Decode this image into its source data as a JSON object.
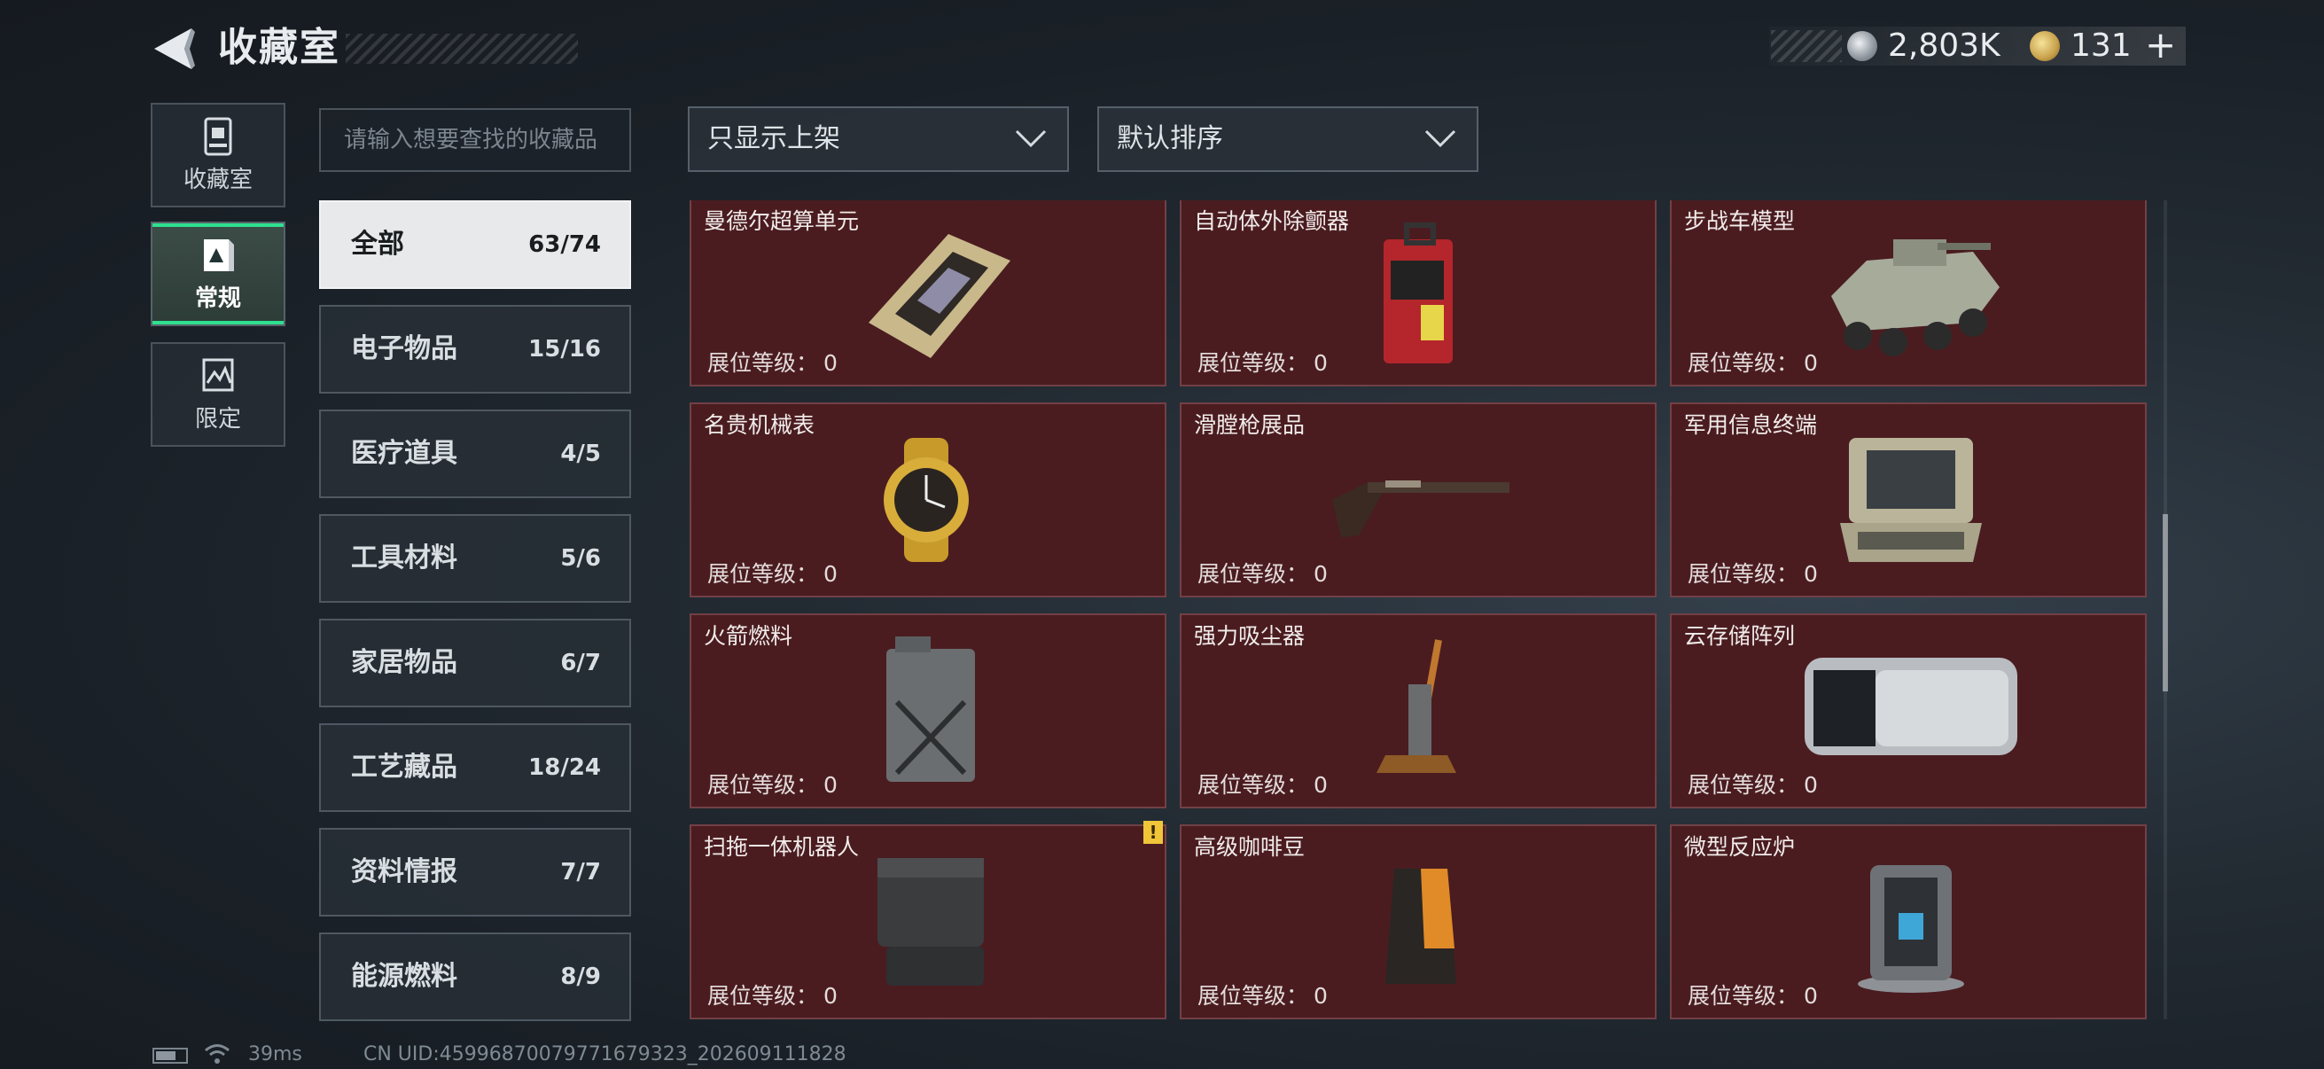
{
  "header": {
    "title": "收藏室",
    "back_icon": "back-arrow-icon"
  },
  "currency": {
    "silver_value": "2,803K",
    "gold_value": "131",
    "plus_label": "+"
  },
  "nav": [
    {
      "label": "收藏室",
      "icon": "vault-icon"
    },
    {
      "label": "常规",
      "icon": "album-icon",
      "active": true
    },
    {
      "label": "限定",
      "icon": "limited-icon"
    }
  ],
  "search": {
    "placeholder": "请输入想要查找的收藏品"
  },
  "filters": {
    "filter_label": "只显示上架",
    "sort_label": "默认排序"
  },
  "categories": [
    {
      "name": "全部",
      "count": "63/74"
    },
    {
      "name": "电子物品",
      "count": "15/16"
    },
    {
      "name": "医疗道具",
      "count": "4/5"
    },
    {
      "name": "工具材料",
      "count": "5/6"
    },
    {
      "name": "家居物品",
      "count": "6/7"
    },
    {
      "name": "工艺藏品",
      "count": "18/24"
    },
    {
      "name": "资料情报",
      "count": "7/7"
    },
    {
      "name": "能源燃料",
      "count": "8/9"
    }
  ],
  "level_prefix": "展位等级：",
  "items": [
    {
      "name": "曼德尔超算单元",
      "level": "0",
      "icon": "supercomputer-unit-icon"
    },
    {
      "name": "自动体外除颤器",
      "level": "0",
      "icon": "defibrillator-icon"
    },
    {
      "name": "步战车模型",
      "level": "0",
      "icon": "ifv-model-icon"
    },
    {
      "name": "名贵机械表",
      "level": "0",
      "icon": "watch-icon"
    },
    {
      "name": "滑膛枪展品",
      "level": "0",
      "icon": "musket-icon"
    },
    {
      "name": "军用信息终端",
      "level": "0",
      "icon": "military-terminal-icon"
    },
    {
      "name": "火箭燃料",
      "level": "0",
      "icon": "fuel-canister-icon"
    },
    {
      "name": "强力吸尘器",
      "level": "0",
      "icon": "vacuum-icon"
    },
    {
      "name": "云存储阵列",
      "level": "0",
      "icon": "storage-array-icon"
    },
    {
      "name": "扫拖一体机器人",
      "level": "0",
      "icon": "mop-robot-icon",
      "badge": "!"
    },
    {
      "name": "高级咖啡豆",
      "level": "0",
      "icon": "coffee-bag-icon"
    },
    {
      "name": "微型反应炉",
      "level": "0",
      "icon": "reactor-icon"
    }
  ],
  "status": {
    "ping": "39ms",
    "uid": "CN UID:459968700797716793​23_202609111828"
  }
}
